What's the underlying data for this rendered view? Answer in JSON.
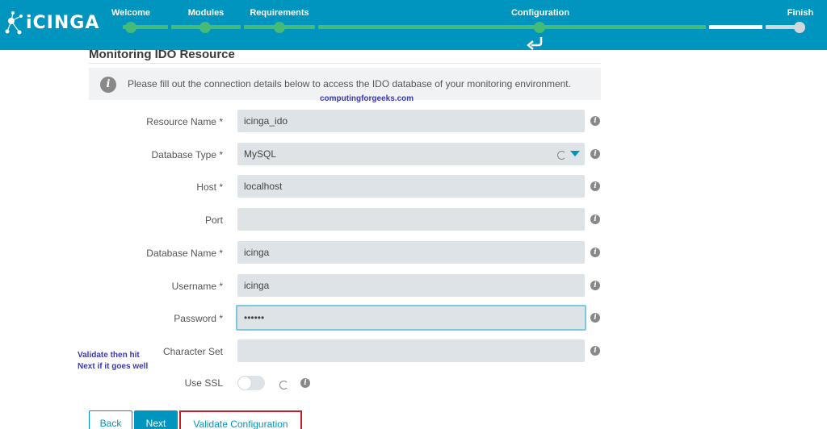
{
  "header": {
    "logo_text": "iCINGA",
    "steps": [
      {
        "label": "Welcome"
      },
      {
        "label": "Modules"
      },
      {
        "label": "Requirements"
      },
      {
        "label": "Configuration"
      },
      {
        "label": "Finish"
      }
    ],
    "colors": {
      "background": "#0095bf",
      "complete": "#44bb77",
      "current": "#ffffff",
      "pending": "#cfd8dc"
    }
  },
  "main": {
    "title": "Monitoring IDO Resource",
    "info": "Please fill out the connection details below to access the IDO database of your monitoring environment.",
    "watermark": "computingforgeeks.com",
    "fields": [
      {
        "label": "Resource Name *",
        "value": "icinga_ido"
      },
      {
        "label": "Database Type *",
        "value": "MySQL"
      },
      {
        "label": "Host *",
        "value": "localhost"
      },
      {
        "label": "Port",
        "value": ""
      },
      {
        "label": "Database Name *",
        "value": "icinga"
      },
      {
        "label": "Username *",
        "value": "icinga"
      },
      {
        "label": "Password *",
        "value": "••••••"
      },
      {
        "label": "Character Set",
        "value": ""
      },
      {
        "label": "Use SSL",
        "value": "off"
      }
    ],
    "annotation_line1": "Validate then hit",
    "annotation_line2": "Next if it goes well"
  },
  "buttons": {
    "back": "Back",
    "next": "Next",
    "validate": "Validate Configuration"
  }
}
